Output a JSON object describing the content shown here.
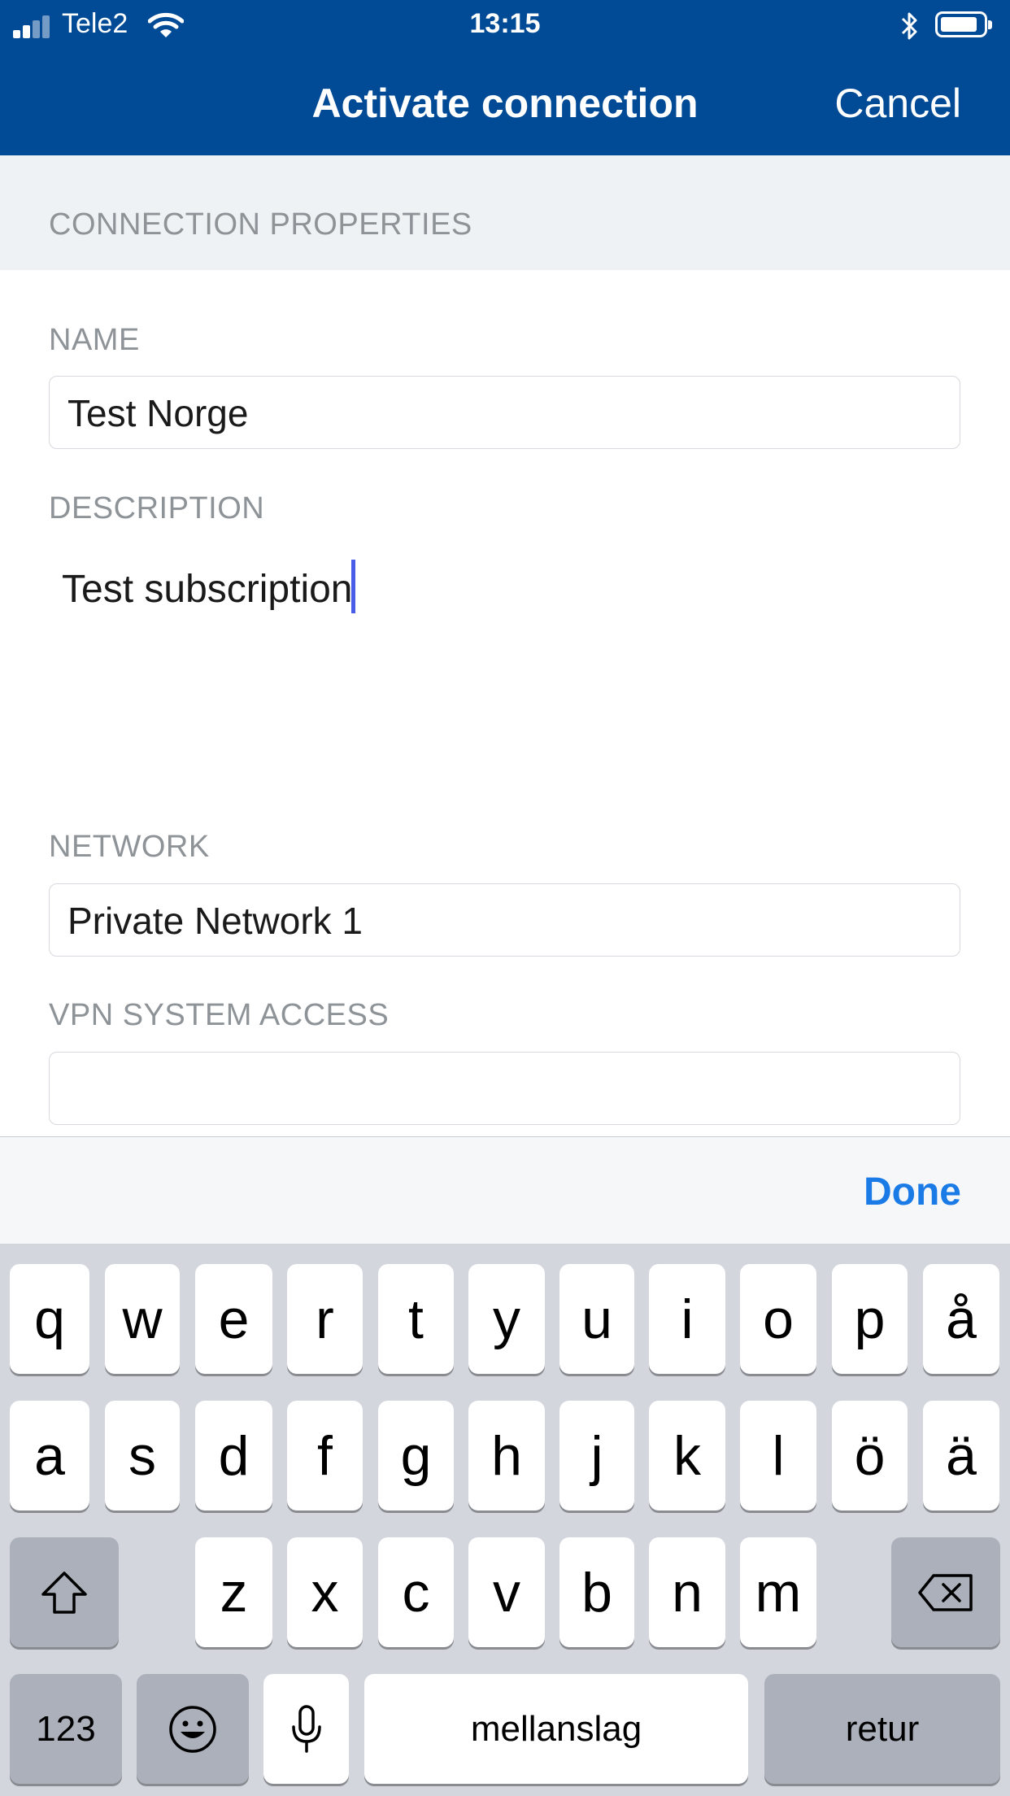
{
  "status_bar": {
    "carrier": "Tele2",
    "time": "13:15"
  },
  "nav": {
    "title": "Activate connection",
    "cancel_label": "Cancel"
  },
  "form": {
    "section_header": "CONNECTION PROPERTIES",
    "name_label": "NAME",
    "name_value": "Test Norge",
    "description_label": "DESCRIPTION",
    "description_value": "Test subscription",
    "network_label": "NETWORK",
    "network_value": "Private Network 1",
    "vpn_label": "VPN SYSTEM ACCESS",
    "vpn_value": ""
  },
  "keyboard": {
    "done_label": "Done",
    "row1": [
      "q",
      "w",
      "e",
      "r",
      "t",
      "y",
      "u",
      "i",
      "o",
      "p",
      "å"
    ],
    "row2": [
      "a",
      "s",
      "d",
      "f",
      "g",
      "h",
      "j",
      "k",
      "l",
      "ö",
      "ä"
    ],
    "row3": [
      "z",
      "x",
      "c",
      "v",
      "b",
      "n",
      "m"
    ],
    "numbers_label": "123",
    "space_label": "mellanslag",
    "return_label": "retur"
  },
  "colors": {
    "nav_background": "#014a96",
    "accent": "#1a7ae6",
    "caret": "#4a5de8"
  }
}
